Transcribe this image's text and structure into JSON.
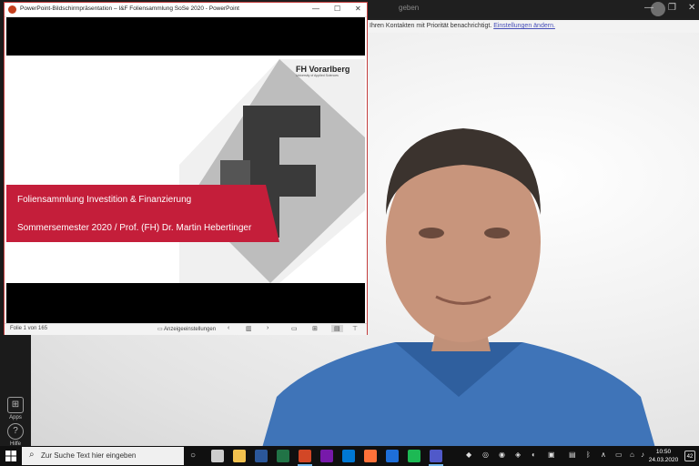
{
  "teams": {
    "search_partial": "geben",
    "banner_text": "Ihren Kontakten mit Priorität benachrichtigt. ",
    "banner_link": "Einstellungen ändern.",
    "rail": [
      {
        "label": "Apps",
        "icon": "apps-icon"
      },
      {
        "label": "Hilfe",
        "icon": "help-icon"
      }
    ]
  },
  "ppt": {
    "window_title": "PowerPoint-Bildschirmpräsentation  –  I&F Foliensammlung SoSe 2020 - PowerPoint",
    "controls": {
      "minimize": "—",
      "maximize": "☐",
      "close": "✕"
    },
    "slide": {
      "logo_name": "FH Vorarlberg",
      "logo_sub": "University of Applied Sciences",
      "title": "Foliensammlung Investition & Finanzierung",
      "subtitle": "Sommersemester 2020 / Prof. (FH) Dr. Martin Hebertinger",
      "accent_color": "#c41e3a"
    },
    "status": {
      "slide_counter": "Folie 1 von 165",
      "display_settings": "Anzeigeeinstellungen",
      "prev": "‹",
      "next": "›"
    }
  },
  "taskbar": {
    "search_placeholder": "Zur Suche Text hier eingeben",
    "clock_time": "10:50",
    "clock_date": "24.03.2020",
    "notification_count": "42",
    "apps": [
      {
        "name": "task-view",
        "color": "#cccccc"
      },
      {
        "name": "file-explorer",
        "color": "#f2c14e"
      },
      {
        "name": "word",
        "color": "#2b579a"
      },
      {
        "name": "excel",
        "color": "#217346"
      },
      {
        "name": "powerpoint",
        "color": "#d24726"
      },
      {
        "name": "onenote",
        "color": "#7719aa"
      },
      {
        "name": "outlook",
        "color": "#0078d4"
      },
      {
        "name": "firefox",
        "color": "#ff7139"
      },
      {
        "name": "app-blue",
        "color": "#1e6fd9"
      },
      {
        "name": "spotify",
        "color": "#1db954"
      },
      {
        "name": "teams",
        "color": "#5059c9"
      }
    ]
  }
}
